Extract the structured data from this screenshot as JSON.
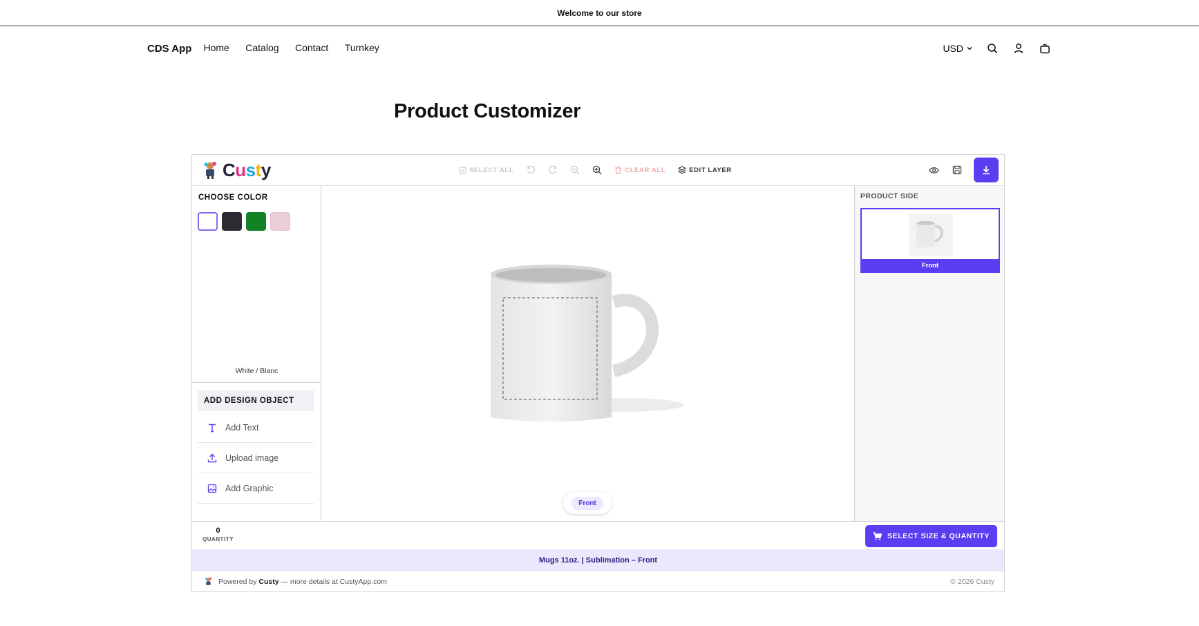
{
  "announcement": "Welcome to our store",
  "store": {
    "brand": "CDS App",
    "nav": [
      "Home",
      "Catalog",
      "Contact",
      "Turnkey"
    ],
    "currency": "USD"
  },
  "page_title": "Product Customizer",
  "customizer": {
    "logo_text": "Custy",
    "toolbar": {
      "select_all": "SELECT ALL",
      "clear_all": "CLEAR ALL",
      "edit_layer": "EDIT LAYER"
    },
    "choose_color_label": "CHOOSE COLOR",
    "colors": [
      {
        "name": "White / Blanc",
        "hex": "#ffffff"
      },
      {
        "name": "Black",
        "hex": "#2b2c31"
      },
      {
        "name": "Green",
        "hex": "#138227"
      },
      {
        "name": "Pink",
        "hex": "#e9cdd8"
      }
    ],
    "selected_color_name": "White / Blanc",
    "add_design_label": "ADD DESIGN OBJECT",
    "design_actions": [
      "Add Text",
      "Upload image",
      "Add Graphic"
    ],
    "canvas_side": "Front",
    "product_side_label": "PRODUCT SIDE",
    "sides": [
      "Front"
    ],
    "quantity": "0",
    "quantity_label": "QUANTITY",
    "select_size_button": "SELECT SIZE & QUANTITY",
    "product_summary": "Mugs 11oz. | Sublimation – Front",
    "footer": {
      "powered_prefix": "Powered by",
      "powered_brand": "Custy",
      "powered_suffix": "— more details at CustyApp.com",
      "copyright": "© 2026 Custy"
    },
    "accent_color": "#5b3df2"
  }
}
